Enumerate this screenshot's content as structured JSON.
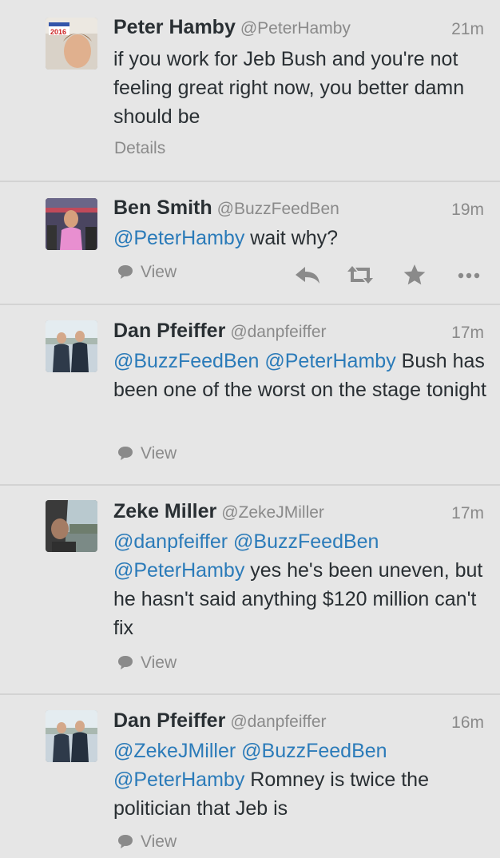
{
  "tweets": [
    {
      "name": "Peter Hamby",
      "handle": "@PeterHamby",
      "time": "21m",
      "segments": [
        {
          "text": "if you work for Jeb Bush and you're not feeling great right now, you better damn should be",
          "mention": false
        }
      ],
      "footer": "Details",
      "avatar_badge": "2016"
    },
    {
      "name": "Ben Smith",
      "handle": "@BuzzFeedBen",
      "time": "19m",
      "segments": [
        {
          "text": "@PeterHamby",
          "mention": true
        },
        {
          "text": " wait why?",
          "mention": false
        }
      ],
      "footer": "View",
      "actions": [
        "reply-icon",
        "retweet-icon",
        "favorite-star-icon",
        "more-dots-icon"
      ]
    },
    {
      "name": "Dan Pfeiffer",
      "handle": "@danpfeiffer",
      "time": "17m",
      "segments": [
        {
          "text": "@BuzzFeedBen",
          "mention": true
        },
        {
          "text": " ",
          "mention": false
        },
        {
          "text": "@PeterHamby",
          "mention": true
        },
        {
          "text": " Bush has been one of the worst on the stage tonight",
          "mention": false
        }
      ],
      "footer": "View"
    },
    {
      "name": "Zeke Miller",
      "handle": "@ZekeJMiller",
      "time": "17m",
      "segments": [
        {
          "text": "@danpfeiffer",
          "mention": true
        },
        {
          "text": " ",
          "mention": false
        },
        {
          "text": "@BuzzFeedBen",
          "mention": true
        },
        {
          "text": " ",
          "mention": false
        },
        {
          "text": "@PeterHamby",
          "mention": true
        },
        {
          "text": " yes he's been uneven, but he hasn't said anything $120 million can't fix",
          "mention": false
        }
      ],
      "footer": "View"
    },
    {
      "name": "Dan Pfeiffer",
      "handle": "@danpfeiffer",
      "time": "16m",
      "segments": [
        {
          "text": "@ZekeJMiller",
          "mention": true
        },
        {
          "text": " ",
          "mention": false
        },
        {
          "text": "@BuzzFeedBen",
          "mention": true
        },
        {
          "text": " ",
          "mention": false
        },
        {
          "text": "@PeterHamby",
          "mention": true
        },
        {
          "text": " Romney is twice the politician that Jeb is",
          "mention": false
        }
      ],
      "footer": "View"
    }
  ],
  "colors": {
    "background": "#e6e6e6",
    "mention": "#2b7bb9",
    "muted": "#8a8a8a",
    "text": "#292f33"
  }
}
